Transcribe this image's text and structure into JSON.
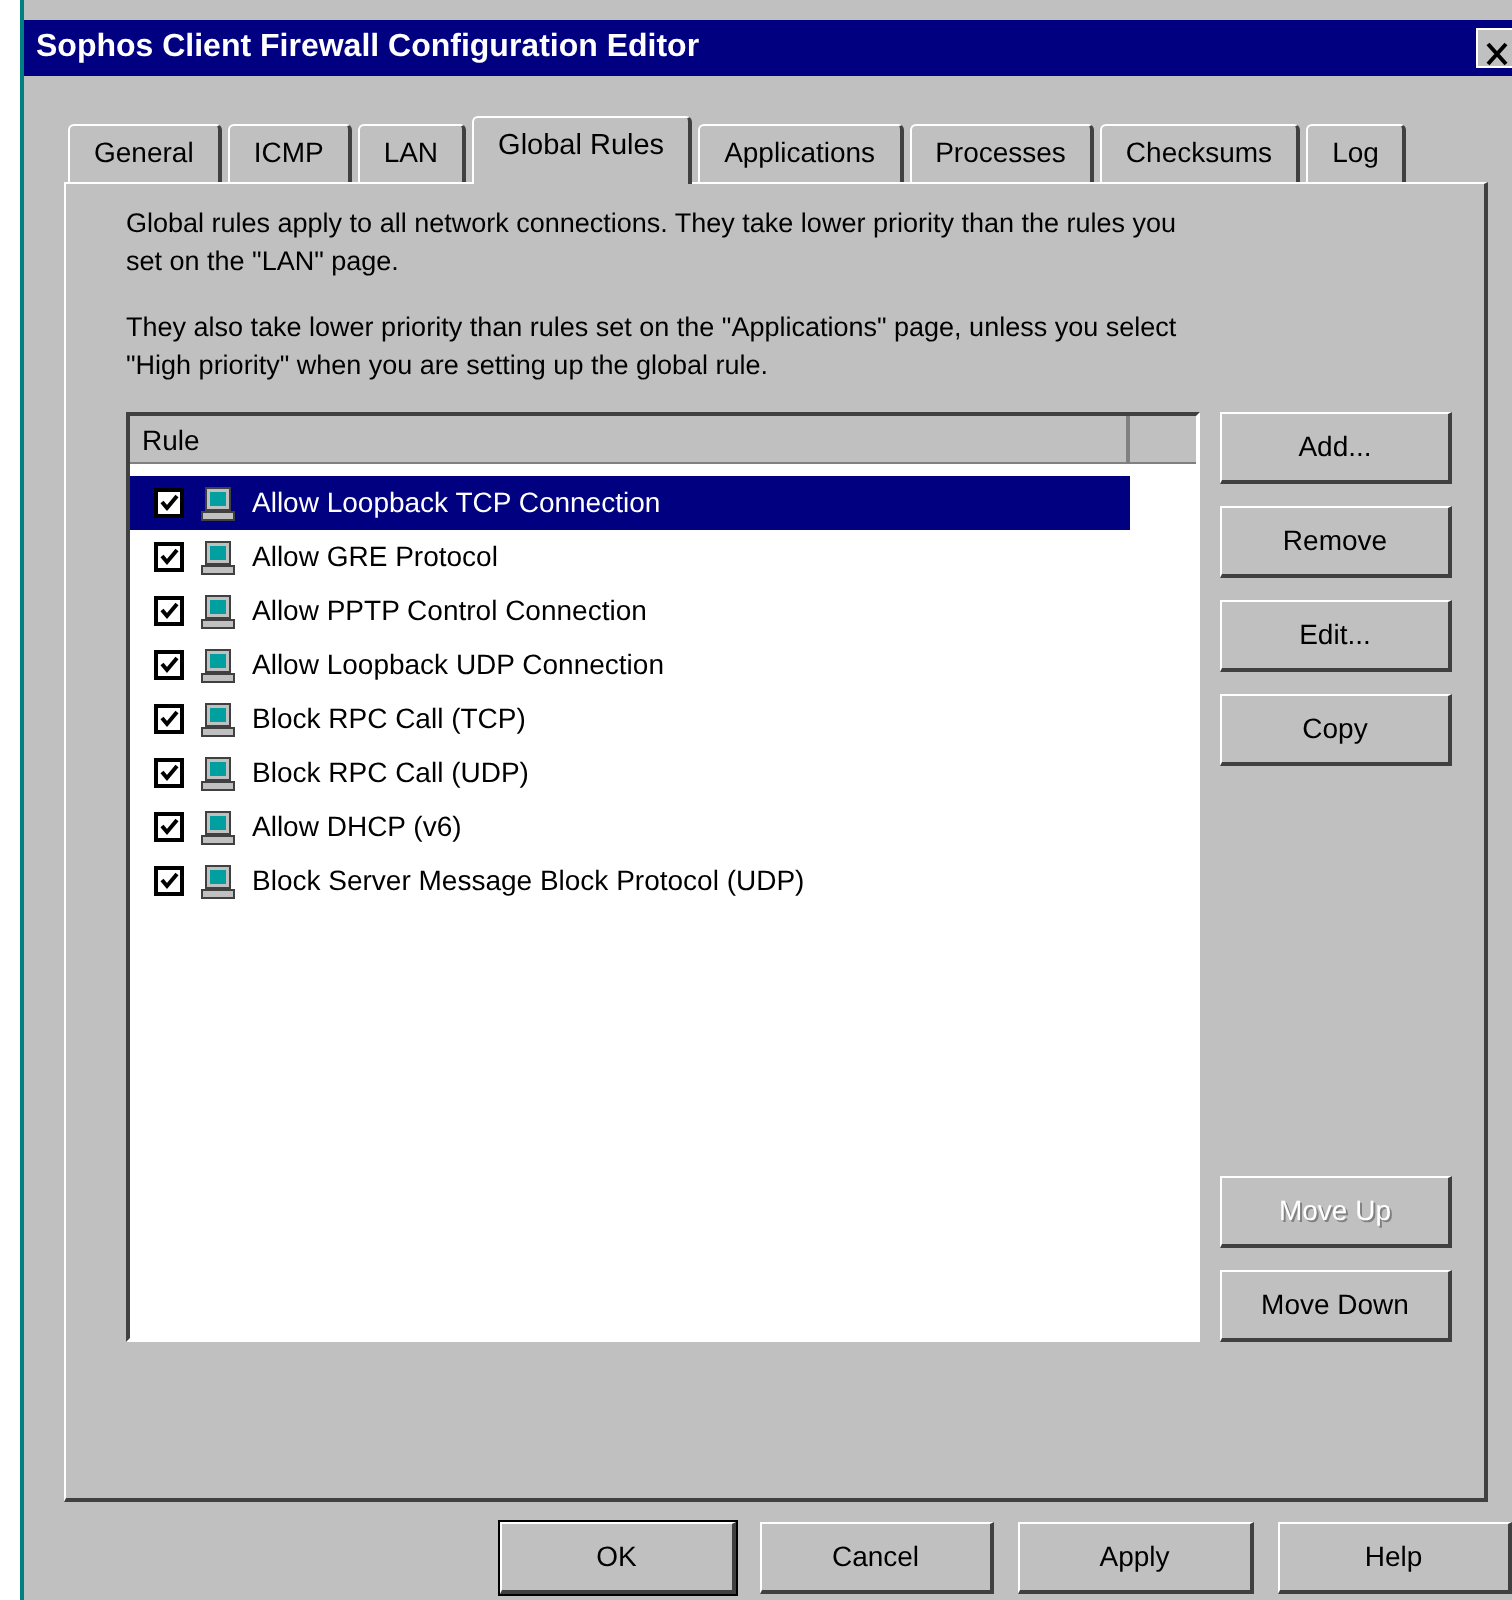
{
  "window": {
    "title": "Sophos Client Firewall Configuration Editor"
  },
  "tabs": [
    {
      "label": "General",
      "selected": false
    },
    {
      "label": "ICMP",
      "selected": false
    },
    {
      "label": "LAN",
      "selected": false
    },
    {
      "label": "Global Rules",
      "selected": true
    },
    {
      "label": "Applications",
      "selected": false
    },
    {
      "label": "Processes",
      "selected": false
    },
    {
      "label": "Checksums",
      "selected": false
    },
    {
      "label": "Log",
      "selected": false
    }
  ],
  "description": [
    "Global rules apply to all network connections. They take lower priority than the rules you set on the \"LAN\" page.",
    "They also take lower priority than rules set on the \"Applications\" page, unless you select \"High priority\" when you are setting up the global rule."
  ],
  "rules_list": {
    "columns": [
      "Rule"
    ],
    "rows": [
      {
        "label": "Allow Loopback TCP Connection",
        "checked": true,
        "selected": true
      },
      {
        "label": "Allow GRE Protocol",
        "checked": true,
        "selected": false
      },
      {
        "label": "Allow PPTP Control Connection",
        "checked": true,
        "selected": false
      },
      {
        "label": "Allow Loopback UDP Connection",
        "checked": true,
        "selected": false
      },
      {
        "label": "Block RPC Call (TCP)",
        "checked": true,
        "selected": false
      },
      {
        "label": "Block RPC Call (UDP)",
        "checked": true,
        "selected": false
      },
      {
        "label": "Allow DHCP (v6)",
        "checked": true,
        "selected": false
      },
      {
        "label": "Block Server Message Block Protocol (UDP)",
        "checked": true,
        "selected": false
      }
    ]
  },
  "side_buttons": [
    {
      "label": "Add...",
      "disabled": false
    },
    {
      "label": "Remove",
      "disabled": false
    },
    {
      "label": "Edit...",
      "disabled": false
    },
    {
      "label": "Copy",
      "disabled": false
    }
  ],
  "move_buttons": [
    {
      "label": "Move Up",
      "disabled": true
    },
    {
      "label": "Move Down",
      "disabled": false
    }
  ],
  "dialog_buttons": [
    {
      "label": "OK",
      "default": true
    },
    {
      "label": "Cancel",
      "default": false
    },
    {
      "label": "Apply",
      "default": false
    },
    {
      "label": "Help",
      "default": false
    }
  ]
}
